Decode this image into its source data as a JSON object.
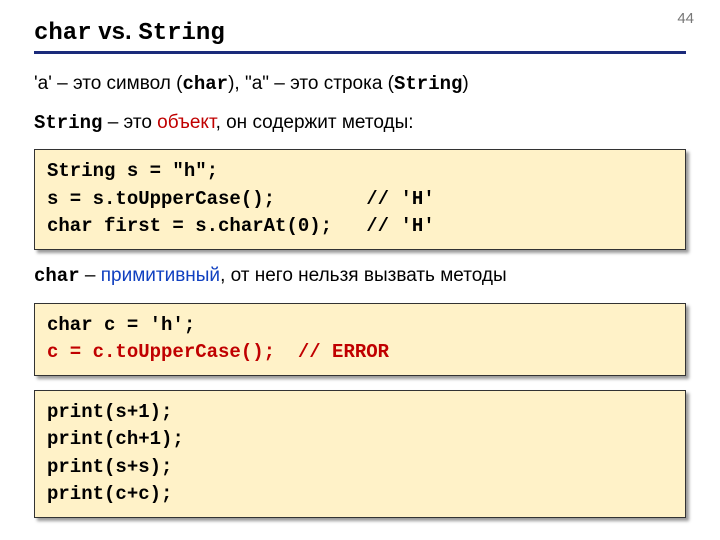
{
  "page_number": "44",
  "title": {
    "t1": "char",
    "t2": " vs. ",
    "t3": "String"
  },
  "line1": {
    "a": "'a' – это символ (",
    "b": "char",
    "c": "), \"a\" – это строка (",
    "d": "String",
    "e": ")"
  },
  "line2": {
    "a": "String",
    "b": " – это ",
    "c": "объект",
    "d": ", он содержит методы:"
  },
  "code1": "String s = \"h\";\ns = s.toUpperCase();        // 'H'\nchar first = s.charAt(0);   // 'H'",
  "line3": {
    "a": "char",
    "b": " – ",
    "c": "примитивный",
    "d": ", от него нельзя вызвать методы"
  },
  "code2": {
    "l1": "char c = 'h';",
    "l2a": "c = c.toUpperCase();  ",
    "l2b": "// ERROR"
  },
  "code3": "print(s+1);\nprint(ch+1);\nprint(s+s);\nprint(c+c);"
}
